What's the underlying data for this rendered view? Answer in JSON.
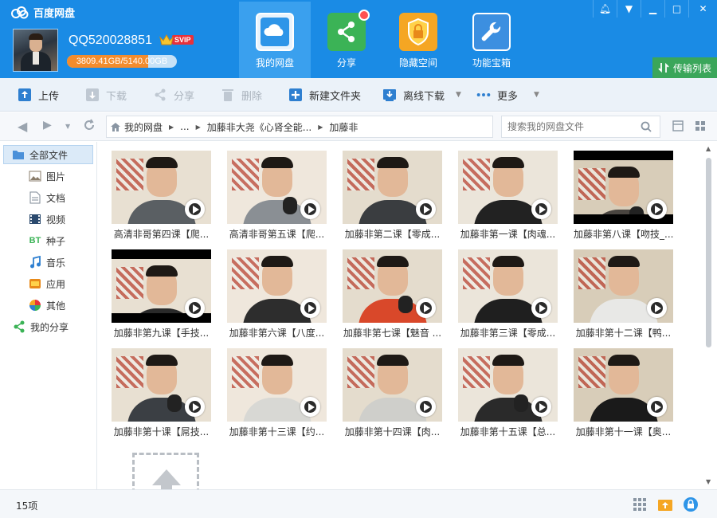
{
  "app": {
    "title": "百度网盘"
  },
  "user": {
    "name": "QQ520028851",
    "vip_badge": "SVIP",
    "quota_text": "3809.41GB/5140.00GB",
    "quota_fraction": 0.741
  },
  "window_controls": {
    "bell": "bell-icon",
    "menu": "menu-icon",
    "minimize": "minimize-icon",
    "maximize": "maximize-icon",
    "close": "close-icon"
  },
  "nav": [
    {
      "label": "我的网盘",
      "icon": "cloud-icon",
      "active": true
    },
    {
      "label": "分享",
      "icon": "share-icon",
      "active": false
    },
    {
      "label": "隐藏空间",
      "icon": "lock-icon",
      "active": false
    },
    {
      "label": "功能宝箱",
      "icon": "wrench-icon",
      "active": false
    }
  ],
  "transfer_label": "传输列表",
  "toolbar": {
    "upload": "上传",
    "download": "下载",
    "share": "分享",
    "delete": "删除",
    "new_folder": "新建文件夹",
    "offline_download": "离线下载",
    "more": "更多"
  },
  "breadcrumb": {
    "home": "我的网盘",
    "ellipsis": "...",
    "parent": "加藤非大尧《心肾全能...",
    "current": "加藤非"
  },
  "search": {
    "placeholder": "搜索我的网盘文件"
  },
  "sidebar": [
    {
      "label": "全部文件",
      "icon": "folder-icon",
      "selected": true,
      "indent": false
    },
    {
      "label": "图片",
      "icon": "image-icon",
      "selected": false,
      "indent": true
    },
    {
      "label": "文档",
      "icon": "document-icon",
      "selected": false,
      "indent": true
    },
    {
      "label": "视频",
      "icon": "video-icon",
      "selected": false,
      "indent": true
    },
    {
      "label": "种子",
      "icon": "bt-icon",
      "selected": false,
      "indent": true
    },
    {
      "label": "音乐",
      "icon": "music-icon",
      "selected": false,
      "indent": true
    },
    {
      "label": "应用",
      "icon": "app-icon",
      "selected": false,
      "indent": true
    },
    {
      "label": "其他",
      "icon": "other-icon",
      "selected": false,
      "indent": true
    },
    {
      "label": "我的分享",
      "icon": "share-icon",
      "selected": false,
      "indent": false
    }
  ],
  "files": [
    {
      "name": "高清非哥第四课【爬...",
      "letterbox": false,
      "shirt": "#5a5f63"
    },
    {
      "name": "高清非哥第五课【爬...",
      "letterbox": false,
      "shirt": "#8a8f94"
    },
    {
      "name": "加藤非第二课【零成...",
      "letterbox": false,
      "shirt": "#3a3d40"
    },
    {
      "name": "加藤非第一课【肉魂...",
      "letterbox": false,
      "shirt": "#222222"
    },
    {
      "name": "加藤非第八课【吻技_...",
      "letterbox": true,
      "shirt": "#4a4540"
    },
    {
      "name": "加藤非第九课【手技...",
      "letterbox": true,
      "shirt": "#2a2a2a"
    },
    {
      "name": "加藤非第六课【八度...",
      "letterbox": false,
      "shirt": "#2d2d2d"
    },
    {
      "name": "加藤非第七课【魅音 ...",
      "letterbox": false,
      "shirt": "#d9482a"
    },
    {
      "name": "加藤非第三课【零成...",
      "letterbox": false,
      "shirt": "#1f1f1f"
    },
    {
      "name": "加藤非第十二课【鸭...",
      "letterbox": false,
      "shirt": "#e8e8e6"
    },
    {
      "name": "加藤非第十课【屌技...",
      "letterbox": false,
      "shirt": "#3b3f44"
    },
    {
      "name": "加藤非第十三课【约...",
      "letterbox": false,
      "shirt": "#d8d8d4"
    },
    {
      "name": "加藤非第十四课【肉...",
      "letterbox": false,
      "shirt": "#cfcfcb"
    },
    {
      "name": "加藤非第十五课【总...",
      "letterbox": false,
      "shirt": "#2a2a2a"
    },
    {
      "name": "加藤非第十一课【奥...",
      "letterbox": false,
      "shirt": "#1a1a1a"
    }
  ],
  "status": {
    "count": "15项"
  }
}
